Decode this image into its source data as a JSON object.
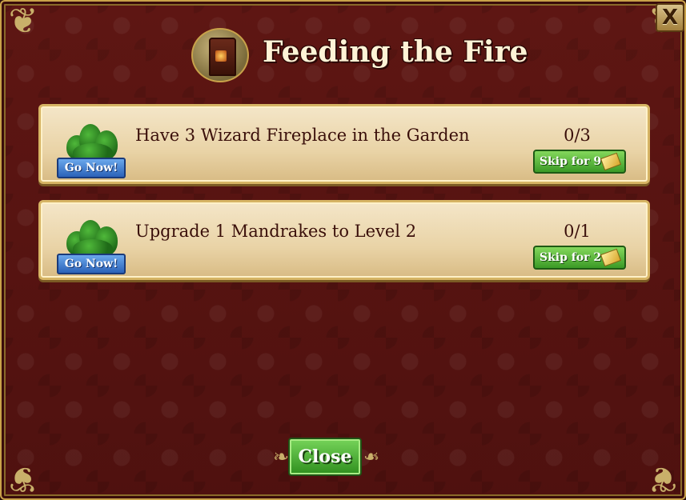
{
  "window": {
    "title": "Feeding the Fire",
    "close_x_label": "X",
    "title_icon": "wizard-fireplace-icon"
  },
  "tasks": [
    {
      "description": "Have 3 Wizard Fireplace in the Garden",
      "progress": "0/3",
      "go_label": "Go Now!",
      "skip_label": "Skip for 9",
      "icon": "mandrake-plant-icon",
      "currency_icon": "gold-bars-icon"
    },
    {
      "description": "Upgrade 1 Mandrakes to Level 2",
      "progress": "0/1",
      "go_label": "Go Now!",
      "skip_label": "Skip for 2",
      "icon": "mandrake-plant-icon",
      "currency_icon": "gold-bars-icon"
    }
  ],
  "footer": {
    "close_label": "Close"
  },
  "colors": {
    "background": "#5a1512",
    "frame": "#c9a24a",
    "go_button": "#2b62b8",
    "skip_button": "#3b9a26",
    "title_text": "#fff3d6"
  }
}
